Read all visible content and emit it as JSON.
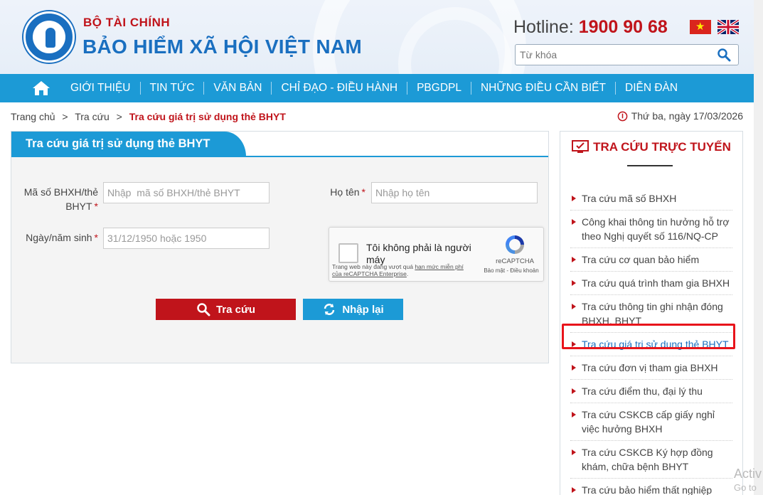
{
  "header": {
    "org_top": "BỘ TÀI CHÍNH",
    "org_main": "BẢO HIỂM XÃ HỘI VIỆT NAM",
    "hotline_label": "Hotline:",
    "hotline_number": "1900 90 68",
    "search_placeholder": "Từ khóa"
  },
  "nav": {
    "items": [
      "GIỚI THIỆU",
      "TIN TỨC",
      "VĂN BẢN",
      "CHỈ ĐẠO - ĐIỀU HÀNH",
      "PBGDPL",
      "NHỮNG ĐIỀU CẦN BIẾT",
      "DIỄN ĐÀN"
    ]
  },
  "breadcrumb": {
    "home": "Trang chủ",
    "sep": ">",
    "section": "Tra cứu",
    "current": "Tra cứu giá trị sử dụng thẻ BHYT"
  },
  "date": "Thứ ba, ngày 17/03/2026",
  "form": {
    "title": "Tra cứu giá trị sử dụng thẻ BHYT",
    "bhxh_label": "Mã số BHXH/thẻ BHYT",
    "bhxh_placeholder": "Nhập  mã số BHXH/thẻ BHYT",
    "name_label": "Họ tên",
    "name_placeholder": "Nhập họ tên",
    "dob_label": "Ngày/năm sinh",
    "dob_placeholder": "31/12/1950 hoặc 1950",
    "required_mark": "*",
    "search_button": "Tra cứu",
    "reset_button": "Nhập lại"
  },
  "recaptcha": {
    "label": "Tôi không phải là người máy",
    "brand": "reCAPTCHA",
    "links": "Bảo mật - Điều khoản",
    "note_prefix": "Trang web này đang vượt quá ",
    "note_link": "hạn mức miễn phí của reCAPTCHA Enterprise",
    "note_suffix": "."
  },
  "sidebar": {
    "title": "TRA CỨU TRỰC TUYẾN",
    "items": [
      "Tra cứu mã số BHXH",
      "Công khai thông tin hưởng hỗ trợ theo Nghị quyết số 116/NQ-CP",
      "Tra cứu cơ quan bảo hiểm",
      "Tra cứu quá trình tham gia BHXH",
      "Tra cứu thông tin ghi nhận đóng BHXH, BHYT",
      "Tra cứu giá trị sử dụng thẻ BHYT",
      "Tra cứu đơn vị tham gia BHXH",
      "Tra cứu điểm thu, đại lý thu",
      "Tra cứu CSKCB cấp giấy nghỉ việc hưởng BHXH",
      "Tra cứu CSKCB Ký hợp đồng khám, chữa bệnh BHYT",
      "Tra cứu bảo hiểm thất nghiệp"
    ],
    "active_index": 5
  },
  "watermark": {
    "line1": "Activ",
    "line2": "Go to"
  },
  "colors": {
    "brand_blue": "#1c9ad6",
    "brand_red": "#c0141b",
    "highlight": "#e8141b"
  }
}
